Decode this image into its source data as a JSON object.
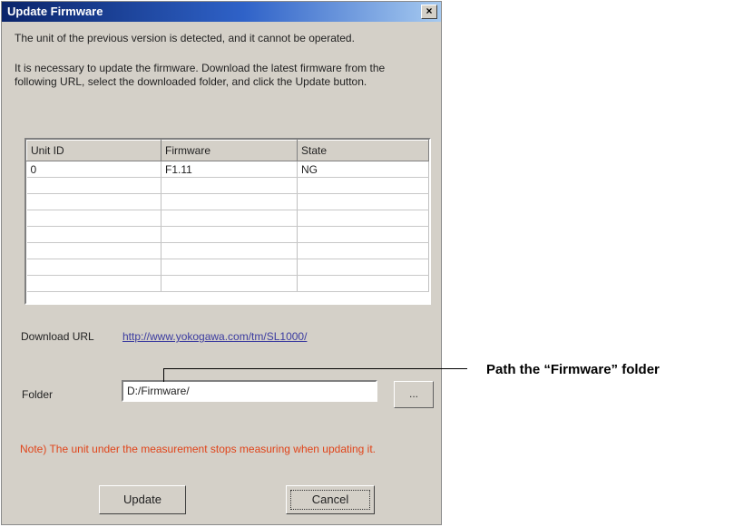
{
  "dialog": {
    "title": "Update Firmware",
    "close_glyph": "×",
    "message1": "The unit of the previous version is detected, and it cannot be operated.",
    "message2": "It is necessary to update the firmware. Download the latest firmware from the following URL, select the downloaded folder, and click the Update button."
  },
  "table": {
    "columns": [
      "Unit ID",
      "Firmware",
      "State"
    ],
    "rows": [
      [
        "0",
        "F1.11",
        "NG"
      ],
      [
        "",
        "",
        ""
      ],
      [
        "",
        "",
        ""
      ],
      [
        "",
        "",
        ""
      ],
      [
        "",
        "",
        ""
      ],
      [
        "",
        "",
        ""
      ],
      [
        "",
        "",
        ""
      ],
      [
        "",
        "",
        ""
      ]
    ],
    "state_ng_color": "#d04a24"
  },
  "download": {
    "label": "Download URL",
    "url_text": "http://www.yokogawa.com/tm/SL1000/"
  },
  "folder": {
    "label": "Folder",
    "value": "D:/Firmware/",
    "browse_label": "..."
  },
  "note": "Note) The unit under the measurement stops measuring when updating it.",
  "buttons": {
    "update": "Update",
    "cancel": "Cancel"
  },
  "callout": {
    "text": "Path the “Firmware” folder"
  }
}
